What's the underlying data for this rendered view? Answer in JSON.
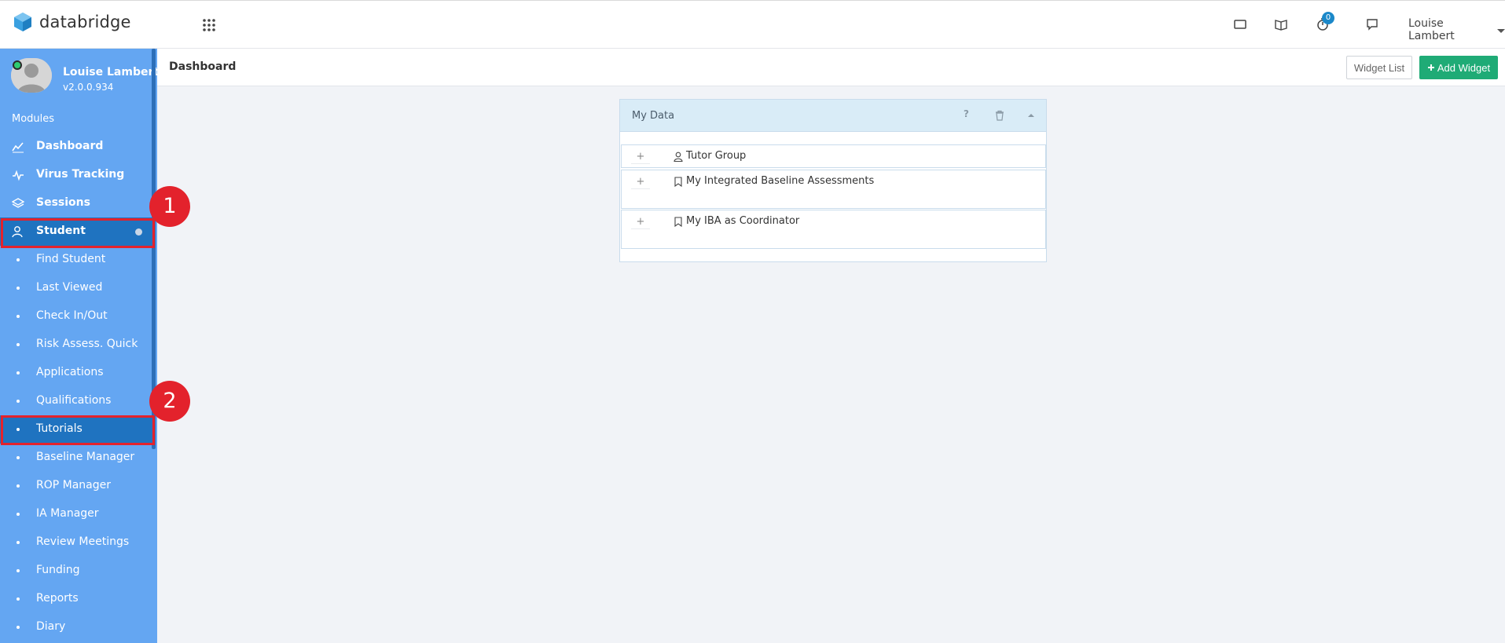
{
  "app": {
    "name": "databridge"
  },
  "topbar": {
    "notification_count": "0",
    "user_name": "Louise Lambert"
  },
  "sidebar": {
    "profile_name": "Louise Lambert",
    "version": "v2.0.0.934",
    "modules_label": "Modules",
    "main_items": [
      {
        "label": "Dashboard",
        "icon": "chart-line-icon"
      },
      {
        "label": "Virus Tracking",
        "icon": "pulse-icon"
      },
      {
        "label": "Sessions",
        "icon": "layers-icon"
      },
      {
        "label": "Student",
        "icon": "student-icon",
        "active": true
      }
    ],
    "sub_items": [
      {
        "label": "Find Student"
      },
      {
        "label": "Last Viewed"
      },
      {
        "label": "Check In/Out"
      },
      {
        "label": "Risk Assess. Quick"
      },
      {
        "label": "Applications"
      },
      {
        "label": "Qualifications"
      },
      {
        "label": "Tutorials",
        "active": true
      },
      {
        "label": "Baseline Manager"
      },
      {
        "label": "ROP Manager"
      },
      {
        "label": "IA Manager"
      },
      {
        "label": "Review Meetings"
      },
      {
        "label": "Funding"
      },
      {
        "label": "Reports"
      },
      {
        "label": "Diary"
      }
    ]
  },
  "callouts": [
    "1",
    "2"
  ],
  "header": {
    "title": "Dashboard",
    "widget_list_label": "Widget List",
    "add_widget_label": "Add Widget"
  },
  "widget": {
    "title": "My Data",
    "help_label": "?",
    "rows": [
      {
        "label": "Tutor Group",
        "icon": "user-icon"
      },
      {
        "label": "My Integrated Baseline Assessments",
        "icon": "bookmark-icon"
      },
      {
        "label": "My IBA as Coordinator",
        "icon": "bookmark-icon"
      }
    ],
    "expand_label": "+"
  },
  "colors": {
    "sidebar": "#64a6f2",
    "sidebar_active": "#1f73c0",
    "callout": "#e3222c",
    "add_widget": "#1fab76",
    "widget_head": "#d9ecf7"
  }
}
